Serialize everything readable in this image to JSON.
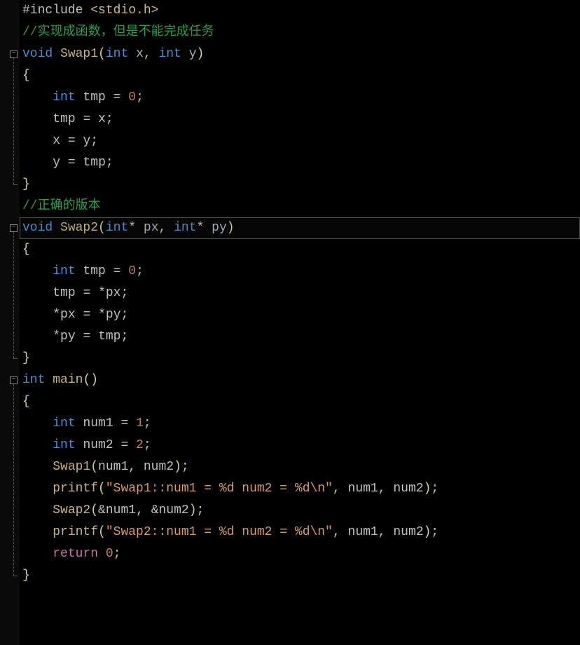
{
  "code": {
    "lines": [
      {
        "indent": 0,
        "tokens": [
          [
            "preproc",
            "#include "
          ],
          [
            "header",
            "<stdio.h>"
          ]
        ]
      },
      {
        "indent": 0,
        "tokens": [
          [
            "comment",
            "//实现成函数，但是不能完成任务"
          ]
        ]
      },
      {
        "indent": 0,
        "tokens": [
          [
            "keyword",
            "void"
          ],
          [
            "punct",
            " "
          ],
          [
            "func",
            "Swap1"
          ],
          [
            "paren",
            "("
          ],
          [
            "type",
            "int"
          ],
          [
            "punct",
            " "
          ],
          [
            "param",
            "x"
          ],
          [
            "punct",
            ", "
          ],
          [
            "type",
            "int"
          ],
          [
            "punct",
            " "
          ],
          [
            "param",
            "y"
          ],
          [
            "paren",
            ")"
          ]
        ]
      },
      {
        "indent": 0,
        "tokens": [
          [
            "brace",
            "{"
          ]
        ]
      },
      {
        "indent": 1,
        "tokens": [
          [
            "type",
            "int"
          ],
          [
            "punct",
            " "
          ],
          [
            "var",
            "tmp"
          ],
          [
            "punct",
            " "
          ],
          [
            "op",
            "="
          ],
          [
            "punct",
            " "
          ],
          [
            "num",
            "0"
          ],
          [
            "punct",
            ";"
          ]
        ]
      },
      {
        "indent": 1,
        "tokens": [
          [
            "var",
            "tmp"
          ],
          [
            "punct",
            " "
          ],
          [
            "op",
            "="
          ],
          [
            "punct",
            " "
          ],
          [
            "var",
            "x"
          ],
          [
            "punct",
            ";"
          ]
        ]
      },
      {
        "indent": 1,
        "tokens": [
          [
            "var",
            "x"
          ],
          [
            "punct",
            " "
          ],
          [
            "op",
            "="
          ],
          [
            "punct",
            " "
          ],
          [
            "var",
            "y"
          ],
          [
            "punct",
            ";"
          ]
        ]
      },
      {
        "indent": 1,
        "tokens": [
          [
            "var",
            "y"
          ],
          [
            "punct",
            " "
          ],
          [
            "op",
            "="
          ],
          [
            "punct",
            " "
          ],
          [
            "var",
            "tmp"
          ],
          [
            "punct",
            ";"
          ]
        ]
      },
      {
        "indent": 0,
        "tokens": [
          [
            "brace",
            "}"
          ]
        ]
      },
      {
        "indent": 0,
        "tokens": [
          [
            "comment",
            "//正确的版本"
          ]
        ]
      },
      {
        "indent": 0,
        "tokens": [
          [
            "keyword",
            "void"
          ],
          [
            "punct",
            " "
          ],
          [
            "func",
            "Swap2"
          ],
          [
            "paren",
            "("
          ],
          [
            "type",
            "int"
          ],
          [
            "op",
            "*"
          ],
          [
            "punct",
            " "
          ],
          [
            "param",
            "px"
          ],
          [
            "punct",
            ", "
          ],
          [
            "type",
            "int"
          ],
          [
            "op",
            "*"
          ],
          [
            "punct",
            " "
          ],
          [
            "param",
            "py"
          ],
          [
            "paren",
            ")"
          ]
        ]
      },
      {
        "indent": 0,
        "tokens": [
          [
            "brace",
            "{"
          ]
        ]
      },
      {
        "indent": 1,
        "tokens": [
          [
            "type",
            "int"
          ],
          [
            "punct",
            " "
          ],
          [
            "var",
            "tmp"
          ],
          [
            "punct",
            " "
          ],
          [
            "op",
            "="
          ],
          [
            "punct",
            " "
          ],
          [
            "num",
            "0"
          ],
          [
            "punct",
            ";"
          ]
        ]
      },
      {
        "indent": 1,
        "tokens": [
          [
            "var",
            "tmp"
          ],
          [
            "punct",
            " "
          ],
          [
            "op",
            "="
          ],
          [
            "punct",
            " "
          ],
          [
            "op",
            "*"
          ],
          [
            "var",
            "px"
          ],
          [
            "punct",
            ";"
          ]
        ]
      },
      {
        "indent": 1,
        "tokens": [
          [
            "op",
            "*"
          ],
          [
            "var",
            "px"
          ],
          [
            "punct",
            " "
          ],
          [
            "op",
            "="
          ],
          [
            "punct",
            " "
          ],
          [
            "op",
            "*"
          ],
          [
            "var",
            "py"
          ],
          [
            "punct",
            ";"
          ]
        ]
      },
      {
        "indent": 1,
        "tokens": [
          [
            "op",
            "*"
          ],
          [
            "var",
            "py"
          ],
          [
            "punct",
            " "
          ],
          [
            "op",
            "="
          ],
          [
            "punct",
            " "
          ],
          [
            "var",
            "tmp"
          ],
          [
            "punct",
            ";"
          ]
        ]
      },
      {
        "indent": 0,
        "tokens": [
          [
            "brace",
            "}"
          ]
        ]
      },
      {
        "indent": 0,
        "tokens": [
          [
            "type",
            "int"
          ],
          [
            "punct",
            " "
          ],
          [
            "func",
            "main"
          ],
          [
            "paren",
            "()"
          ]
        ]
      },
      {
        "indent": 0,
        "tokens": [
          [
            "brace",
            "{"
          ]
        ]
      },
      {
        "indent": 1,
        "tokens": [
          [
            "type",
            "int"
          ],
          [
            "punct",
            " "
          ],
          [
            "var",
            "num1"
          ],
          [
            "punct",
            " "
          ],
          [
            "op",
            "="
          ],
          [
            "punct",
            " "
          ],
          [
            "num",
            "1"
          ],
          [
            "punct",
            ";"
          ]
        ]
      },
      {
        "indent": 1,
        "tokens": [
          [
            "type",
            "int"
          ],
          [
            "punct",
            " "
          ],
          [
            "var",
            "num2"
          ],
          [
            "punct",
            " "
          ],
          [
            "op",
            "="
          ],
          [
            "punct",
            " "
          ],
          [
            "num",
            "2"
          ],
          [
            "punct",
            ";"
          ]
        ]
      },
      {
        "indent": 1,
        "tokens": [
          [
            "func",
            "Swap1"
          ],
          [
            "paren",
            "("
          ],
          [
            "var",
            "num1"
          ],
          [
            "punct",
            ", "
          ],
          [
            "var",
            "num2"
          ],
          [
            "paren",
            ")"
          ],
          [
            "punct",
            ";"
          ]
        ]
      },
      {
        "indent": 1,
        "tokens": [
          [
            "func",
            "printf"
          ],
          [
            "paren",
            "("
          ],
          [
            "string",
            "\"Swap1::num1 = %d num2 = %d\\n\""
          ],
          [
            "punct",
            ", "
          ],
          [
            "var",
            "num1"
          ],
          [
            "punct",
            ", "
          ],
          [
            "var",
            "num2"
          ],
          [
            "paren",
            ")"
          ],
          [
            "punct",
            ";"
          ]
        ]
      },
      {
        "indent": 1,
        "tokens": [
          [
            "func",
            "Swap2"
          ],
          [
            "paren",
            "("
          ],
          [
            "op",
            "&"
          ],
          [
            "var",
            "num1"
          ],
          [
            "punct",
            ", "
          ],
          [
            "op",
            "&"
          ],
          [
            "var",
            "num2"
          ],
          [
            "paren",
            ")"
          ],
          [
            "punct",
            ";"
          ]
        ]
      },
      {
        "indent": 1,
        "tokens": [
          [
            "func",
            "printf"
          ],
          [
            "paren",
            "("
          ],
          [
            "string",
            "\"Swap2::num1 = %d num2 = %d\\n\""
          ],
          [
            "punct",
            ", "
          ],
          [
            "var",
            "num1"
          ],
          [
            "punct",
            ", "
          ],
          [
            "var",
            "num2"
          ],
          [
            "paren",
            ")"
          ],
          [
            "punct",
            ";"
          ]
        ]
      },
      {
        "indent": 1,
        "tokens": [
          [
            "return",
            "return"
          ],
          [
            "punct",
            " "
          ],
          [
            "num",
            "0"
          ],
          [
            "punct",
            ";"
          ]
        ]
      },
      {
        "indent": 0,
        "tokens": [
          [
            "brace",
            "}"
          ]
        ]
      }
    ],
    "folds": [
      {
        "box_line": 2,
        "start": 3,
        "end": 8
      },
      {
        "box_line": 10,
        "start": 11,
        "end": 16
      },
      {
        "box_line": 17,
        "start": 18,
        "end": 26
      }
    ],
    "highlighted_line": 10,
    "fold_glyph": "−"
  }
}
